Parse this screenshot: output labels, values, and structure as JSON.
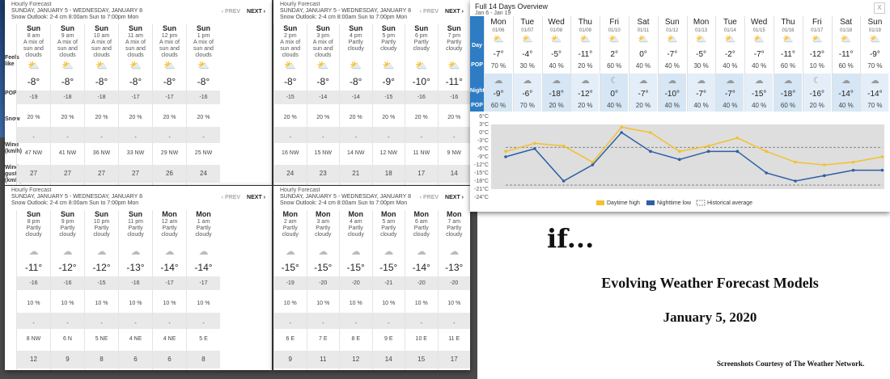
{
  "panels": [
    {
      "title": "Hourly Forecast",
      "dates": "SUNDAY, JANUARY 5 - WEDNESDAY, JANUARY 8",
      "outlook": "Snow Outlook: 2-4 cm 8:00am Sun to 7:00pm Mon",
      "prev": "PREV",
      "next": "NEXT",
      "row_labels": {
        "feels": "Feels like",
        "pop": "POP",
        "snow": "Snow",
        "wind": "Wind (km/h)",
        "gust": "Wind gust (km/h)"
      },
      "hours": [
        {
          "day": "Sun",
          "time": "8 am",
          "cond": "A mix of sun and clouds",
          "icon": "sun-cloud-snow-icon",
          "temp": "-8°",
          "feels": "-19",
          "pop": "20 %",
          "snow": "-",
          "wind": "47 NW",
          "gust": "27"
        },
        {
          "day": "Sun",
          "time": "9 am",
          "cond": "A mix of sun and clouds",
          "icon": "sun-cloud-snow-icon",
          "temp": "-8°",
          "feels": "-18",
          "pop": "20 %",
          "snow": "-",
          "wind": "41 NW",
          "gust": "27"
        },
        {
          "day": "Sun",
          "time": "10 am",
          "cond": "A mix of sun and clouds",
          "icon": "sun-cloud-snow-icon",
          "temp": "-8°",
          "feels": "-18",
          "pop": "20 %",
          "snow": "-",
          "wind": "36 NW",
          "gust": "27"
        },
        {
          "day": "Sun",
          "time": "11 am",
          "cond": "A mix of sun and clouds",
          "icon": "sun-cloud-snow-icon",
          "temp": "-8°",
          "feels": "-17",
          "pop": "20 %",
          "snow": "-",
          "wind": "33 NW",
          "gust": "27"
        },
        {
          "day": "Sun",
          "time": "12 pm",
          "cond": "A mix of sun and clouds",
          "icon": "sun-cloud-snow-icon",
          "temp": "-8°",
          "feels": "-17",
          "pop": "20 %",
          "snow": "-",
          "wind": "29 NW",
          "gust": "26"
        },
        {
          "day": "Sun",
          "time": "1 pm",
          "cond": "A mix of sun and clouds",
          "icon": "sun-cloud-snow-icon",
          "temp": "-8°",
          "feels": "-16",
          "pop": "20 %",
          "snow": "-",
          "wind": "25 NW",
          "gust": "24"
        }
      ]
    },
    {
      "title": "Hourly Forecast",
      "dates": "SUNDAY, JANUARY 5 - WEDNESDAY, JANUARY 8",
      "outlook": "Snow Outlook: 2-4 cm 8:00am Sun to 7:00pm Mon",
      "prev": "PREV",
      "next": "NEXT",
      "hours": [
        {
          "day": "Sun",
          "time": "2 pm",
          "cond": "A mix of sun and clouds",
          "icon": "sun-cloud-snow-icon",
          "temp": "-8°",
          "feels": "-15",
          "pop": "20 %",
          "snow": "-",
          "wind": "16 NW",
          "gust": "24"
        },
        {
          "day": "Sun",
          "time": "3 pm",
          "cond": "A mix of sun and clouds",
          "icon": "sun-cloud-snow-icon",
          "temp": "-8°",
          "feels": "-14",
          "pop": "20 %",
          "snow": "-",
          "wind": "15 NW",
          "gust": "23"
        },
        {
          "day": "Sun",
          "time": "4 pm",
          "cond": "Partly cloudy",
          "icon": "partly-cloudy-icon",
          "temp": "-8°",
          "feels": "-14",
          "pop": "20 %",
          "snow": "-",
          "wind": "14 NW",
          "gust": "21"
        },
        {
          "day": "Sun",
          "time": "5 pm",
          "cond": "Partly cloudy",
          "icon": "partly-cloudy-icon",
          "temp": "-9°",
          "feels": "-15",
          "pop": "20 %",
          "snow": "-",
          "wind": "12 NW",
          "gust": "18"
        },
        {
          "day": "Sun",
          "time": "6 pm",
          "cond": "Partly cloudy",
          "icon": "partly-cloudy-icon",
          "temp": "-10°",
          "feels": "-16",
          "pop": "20 %",
          "snow": "-",
          "wind": "11 NW",
          "gust": "17"
        },
        {
          "day": "Sun",
          "time": "7 pm",
          "cond": "Partly cloudy",
          "icon": "partly-cloudy-icon",
          "temp": "-11°",
          "feels": "-16",
          "pop": "20 %",
          "snow": "-",
          "wind": "9 NW",
          "gust": "14"
        }
      ]
    },
    {
      "title": "Hourly Forecast",
      "dates": "SUNDAY, JANUARY 5 - WEDNESDAY, JANUARY 8",
      "outlook": "Snow Outlook: 2-4 cm 8:00am Sun to 7:00pm Mon",
      "prev": "PREV",
      "next": "NEXT",
      "hours": [
        {
          "day": "Sun",
          "time": "8 pm",
          "cond": "Partly cloudy",
          "icon": "partly-cloudy-night-icon",
          "temp": "-11°",
          "feels": "-16",
          "pop": "10 %",
          "snow": "-",
          "wind": "8 NW",
          "gust": "12"
        },
        {
          "day": "Sun",
          "time": "9 pm",
          "cond": "Partly cloudy",
          "icon": "partly-cloudy-night-icon",
          "temp": "-12°",
          "feels": "-16",
          "pop": "10 %",
          "snow": "-",
          "wind": "6 N",
          "gust": "9"
        },
        {
          "day": "Sun",
          "time": "10 pm",
          "cond": "Partly cloudy",
          "icon": "partly-cloudy-night-icon",
          "temp": "-12°",
          "feels": "-15",
          "pop": "10 %",
          "snow": "-",
          "wind": "5 NE",
          "gust": "8"
        },
        {
          "day": "Sun",
          "time": "11 pm",
          "cond": "Partly cloudy",
          "icon": "partly-cloudy-night-icon",
          "temp": "-13°",
          "feels": "-16",
          "pop": "10 %",
          "snow": "-",
          "wind": "4 NE",
          "gust": "6"
        },
        {
          "day": "Mon",
          "time": "12 am",
          "cond": "Partly cloudy",
          "icon": "partly-cloudy-night-icon",
          "temp": "-14°",
          "feels": "-17",
          "pop": "10 %",
          "snow": "-",
          "wind": "4 NE",
          "gust": "6"
        },
        {
          "day": "Mon",
          "time": "1 am",
          "cond": "Partly cloudy",
          "icon": "partly-cloudy-night-icon",
          "temp": "-14°",
          "feels": "-17",
          "pop": "10 %",
          "snow": "-",
          "wind": "5 E",
          "gust": "8"
        }
      ]
    },
    {
      "title": "Hourly Forecast",
      "dates": "SUNDAY, JANUARY 5 - WEDNESDAY, JANUARY 8",
      "outlook": "Snow Outlook: 2-4 cm 8:00am Sun to 7:00pm Mon",
      "prev": "PREV",
      "next": "NEXT",
      "hours": [
        {
          "day": "Mon",
          "time": "2 am",
          "cond": "Partly cloudy",
          "icon": "partly-cloudy-night-icon",
          "temp": "-15°",
          "feels": "-19",
          "pop": "10 %",
          "snow": "-",
          "wind": "6 E",
          "gust": "9"
        },
        {
          "day": "Mon",
          "time": "3 am",
          "cond": "Partly cloudy",
          "icon": "partly-cloudy-night-icon",
          "temp": "-15°",
          "feels": "-20",
          "pop": "10 %",
          "snow": "-",
          "wind": "7 E",
          "gust": "11"
        },
        {
          "day": "Mon",
          "time": "4 am",
          "cond": "Partly cloudy",
          "icon": "partly-cloudy-night-icon",
          "temp": "-15°",
          "feels": "-20",
          "pop": "10 %",
          "snow": "-",
          "wind": "8 E",
          "gust": "12"
        },
        {
          "day": "Mon",
          "time": "5 am",
          "cond": "Partly cloudy",
          "icon": "partly-cloudy-night-icon",
          "temp": "-15°",
          "feels": "-21",
          "pop": "10 %",
          "snow": "-",
          "wind": "9 E",
          "gust": "14"
        },
        {
          "day": "Mon",
          "time": "6 am",
          "cond": "Partly cloudy",
          "icon": "partly-cloudy-night-icon",
          "temp": "-14°",
          "feels": "-20",
          "pop": "10 %",
          "snow": "-",
          "wind": "10 E",
          "gust": "15"
        },
        {
          "day": "Mon",
          "time": "7 am",
          "cond": "Partly cloudy",
          "icon": "partly-cloudy-night-icon",
          "temp": "-13°",
          "feels": "-20",
          "pop": "10 %",
          "snow": "-",
          "wind": "11 E",
          "gust": "17"
        }
      ]
    }
  ],
  "overview": {
    "title": "Full 14 Days Overview",
    "dates": "Jan 6 - Jan 19",
    "close": "X",
    "labels": {
      "day": "Day",
      "pop": "POP",
      "night": "Night"
    },
    "days": [
      {
        "name": "Mon",
        "date": "01/06",
        "high": "-7°",
        "day_pop": "70 %",
        "low": "-9°",
        "night_pop": "60 %"
      },
      {
        "name": "Tue",
        "date": "01/07",
        "high": "-4°",
        "day_pop": "30 %",
        "low": "-6°",
        "night_pop": "70 %"
      },
      {
        "name": "Wed",
        "date": "01/08",
        "high": "-5°",
        "day_pop": "40 %",
        "low": "-18°",
        "night_pop": "20 %"
      },
      {
        "name": "Thu",
        "date": "01/09",
        "high": "-11°",
        "day_pop": "20 %",
        "low": "-12°",
        "night_pop": "20 %"
      },
      {
        "name": "Fri",
        "date": "01/10",
        "high": "2°",
        "day_pop": "60 %",
        "low": "0°",
        "night_pop": "40 %"
      },
      {
        "name": "Sat",
        "date": "01/11",
        "high": "0°",
        "day_pop": "40 %",
        "low": "-7°",
        "night_pop": "20 %"
      },
      {
        "name": "Sun",
        "date": "01/12",
        "high": "-7°",
        "day_pop": "40 %",
        "low": "-10°",
        "night_pop": "40 %"
      },
      {
        "name": "Mon",
        "date": "01/13",
        "high": "-5°",
        "day_pop": "30 %",
        "low": "-7°",
        "night_pop": "40 %"
      },
      {
        "name": "Tue",
        "date": "01/14",
        "high": "-2°",
        "day_pop": "40 %",
        "low": "-7°",
        "night_pop": "40 %"
      },
      {
        "name": "Wed",
        "date": "01/15",
        "high": "-7°",
        "day_pop": "40 %",
        "low": "-15°",
        "night_pop": "40 %"
      },
      {
        "name": "Thu",
        "date": "01/16",
        "high": "-11°",
        "day_pop": "60 %",
        "low": "-18°",
        "night_pop": "60 %"
      },
      {
        "name": "Fri",
        "date": "01/17",
        "high": "-12°",
        "day_pop": "10 %",
        "low": "-16°",
        "night_pop": "20 %"
      },
      {
        "name": "Sat",
        "date": "01/18",
        "high": "-11°",
        "day_pop": "60 %",
        "low": "-14°",
        "night_pop": "40 %"
      },
      {
        "name": "Sun",
        "date": "01/19",
        "high": "-9°",
        "day_pop": "70 %",
        "low": "-14°",
        "night_pop": "70 %"
      }
    ]
  },
  "chart_data": {
    "type": "line",
    "x": [
      "01/06",
      "01/07",
      "01/08",
      "01/09",
      "01/10",
      "01/11",
      "01/12",
      "01/13",
      "01/14",
      "01/15",
      "01/16",
      "01/17",
      "01/18",
      "01/19"
    ],
    "series": [
      {
        "name": "Daytime high",
        "color": "#f2c12e",
        "values": [
          -7,
          -4,
          -5,
          -11,
          2,
          0,
          -7,
          -5,
          -2,
          -7,
          -11,
          -12,
          -11,
          -9
        ]
      },
      {
        "name": "Nighttime low",
        "color": "#2e5fa3",
        "values": [
          -9,
          -6,
          -18,
          -12,
          0,
          -7,
          -10,
          -7,
          -7,
          -15,
          -18,
          -16,
          -14,
          -14
        ]
      },
      {
        "name": "Historical average",
        "color": "#999999",
        "values": [
          -5.5,
          -5.5,
          -5.5,
          -5.5,
          -5.5,
          -5.5,
          -5.5,
          -5.5,
          -5.5,
          -5.5,
          -5.5,
          -5.5,
          -5.5,
          -5.5
        ]
      }
    ],
    "historical_low": -19.5,
    "yticks": [
      "6°C",
      "3°C",
      "0°C",
      "-3°C",
      "-6°C",
      "-9°C",
      "-12°C",
      "-15°C",
      "-18°C",
      "-21°C",
      "-24°C"
    ],
    "ylim": [
      -24,
      6
    ],
    "legend": "bottom"
  },
  "slide": {
    "if_text": "if...",
    "title": "Evolving Weather Forecast Models",
    "date": "January 5, 2020",
    "credit": "Screenshots Courtesy of The Weather Network."
  }
}
